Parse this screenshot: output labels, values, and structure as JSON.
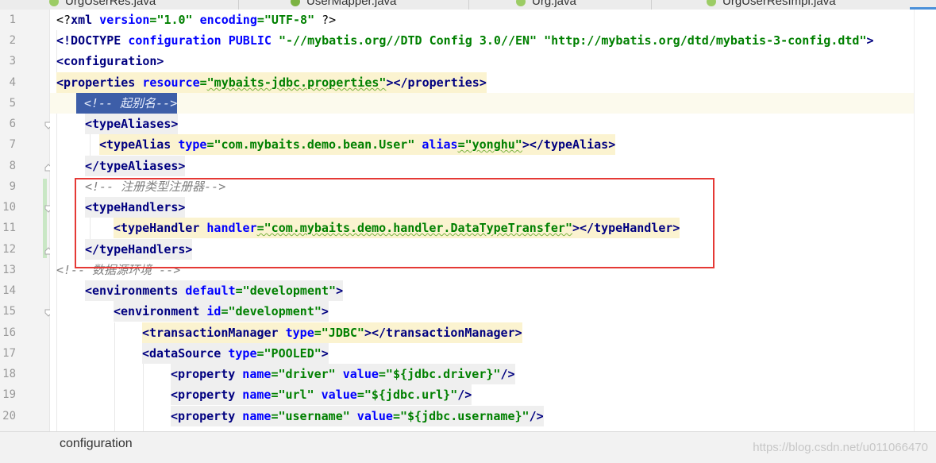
{
  "tabs": [
    {
      "label": "UrgUserRes.java"
    },
    {
      "label": "UserMapper.java"
    },
    {
      "label": "Urg.java"
    },
    {
      "label": "UrgUserResImpl.java"
    }
  ],
  "lines": [
    {
      "n": "1"
    },
    {
      "n": "2"
    },
    {
      "n": "3"
    },
    {
      "n": "4"
    },
    {
      "n": "5"
    },
    {
      "n": "6"
    },
    {
      "n": "7"
    },
    {
      "n": "8"
    },
    {
      "n": "9"
    },
    {
      "n": "10"
    },
    {
      "n": "11"
    },
    {
      "n": "12"
    },
    {
      "n": "13"
    },
    {
      "n": "14"
    },
    {
      "n": "15"
    },
    {
      "n": "16"
    },
    {
      "n": "17"
    },
    {
      "n": "18"
    },
    {
      "n": "19"
    },
    {
      "n": "20"
    }
  ],
  "code": {
    "l1_open": "<?",
    "l1_tag": "xml",
    "l1_a1": " version",
    "l1_eq1": "=",
    "l1_v1": "\"1.0\"",
    "l1_a2": " encoding",
    "l1_eq2": "=",
    "l1_v2": "\"UTF-8\"",
    "l1_close": " ?>",
    "l2_tag": "<!DOCTYPE ",
    "l2_a1": "configuration PUBLIC ",
    "l2_v1": "\"-//mybatis.org//DTD Config 3.0//EN\"",
    "l2_v2": " \"http://mybatis.org/dtd/mybatis-3-config.dtd\"",
    "l2_end": ">",
    "l3": "<configuration>",
    "l4_tag": "<properties",
    "l4_a1": " resource",
    "l4_eq": "=",
    "l4_v1": "\"mybaits-jdbc.properties\"",
    "l4_end": "></properties>",
    "l5": "<!-- 起别名-->",
    "l6": "<typeAliases>",
    "l7_tag": "<typeAlias",
    "l7_a1": " type",
    "l7_v1": "=\"com.mybaits.demo.bean.User\"",
    "l7_a2": " alias",
    "l7_v2": "=\"yonghu\"",
    "l7_end": "></typeAlias>",
    "l8": "</typeAliases>",
    "l9": "<!-- 注册类型注册器-->",
    "l10": "<typeHandlers>",
    "l11_tag": "<typeHandler",
    "l11_a1": " handler",
    "l11_v1": "=\"com.mybaits.demo.handler.DataTypeTransfer\"",
    "l11_end": "></typeHandler>",
    "l12": "</typeHandlers>",
    "l13": "<!-- 数据源环境 -->",
    "l14_tag": "<environments",
    "l14_a1": " default",
    "l14_v1": "=\"development\"",
    "l14_end": ">",
    "l15_tag": "<environment",
    "l15_a1": " id",
    "l15_v1": "=\"development\"",
    "l15_end": ">",
    "l16_tag": "<transactionManager",
    "l16_a1": " type",
    "l16_v1": "=\"JDBC\"",
    "l16_end": "></transactionManager>",
    "l17_tag": "<dataSource",
    "l17_a1": " type",
    "l17_v1": "=\"POOLED\"",
    "l17_end": ">",
    "l18_tag": "<property",
    "l18_a1": " name",
    "l18_v1": "=\"driver\"",
    "l18_a2": " value",
    "l18_v2": "=\"${jdbc.driver}\"",
    "l18_end": "/>",
    "l19_tag": "<property",
    "l19_a1": " name",
    "l19_v1": "=\"url\"",
    "l19_a2": " value",
    "l19_v2": "=\"${jdbc.url}\"",
    "l19_end": "/>",
    "l20_tag": "<property",
    "l20_a1": " name",
    "l20_v1": "=\"username\"",
    "l20_a2": " value",
    "l20_v2": "=\"${jdbc.username}\"",
    "l20_end": "/>"
  },
  "status": {
    "breadcrumb": "configuration",
    "watermark": "https://blog.csdn.net/u011066470"
  },
  "colors": {
    "tag": "#000080",
    "attribute": "#0000ff",
    "value": "#008000",
    "comment": "#808080",
    "highlight_box": "#e53935"
  }
}
